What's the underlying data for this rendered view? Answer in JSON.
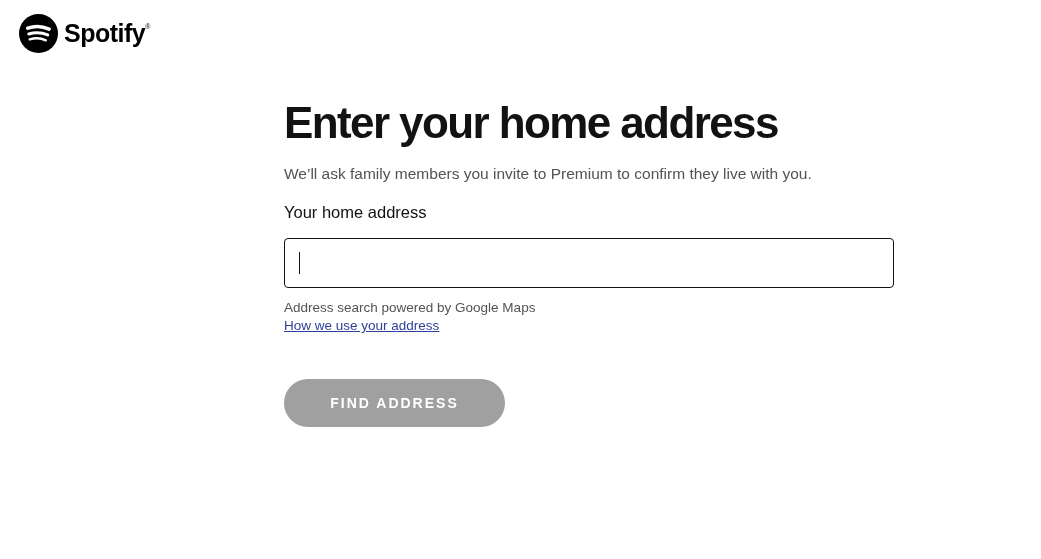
{
  "logo": {
    "text": "Spotify$^{®}$"
  },
  "heading": "Enter your home address",
  "subtitle": "We’ll ask family members you invite to Premium to confirm they live with you.",
  "address_field": {
    "label": "Your home address",
    "focused": true
  },
  "helper_text": "Address search powered by Google Maps",
  "link": "How we use your address",
  "button": {
    "label": "FIND ADDRESS",
    "disabled": true
  }
}
